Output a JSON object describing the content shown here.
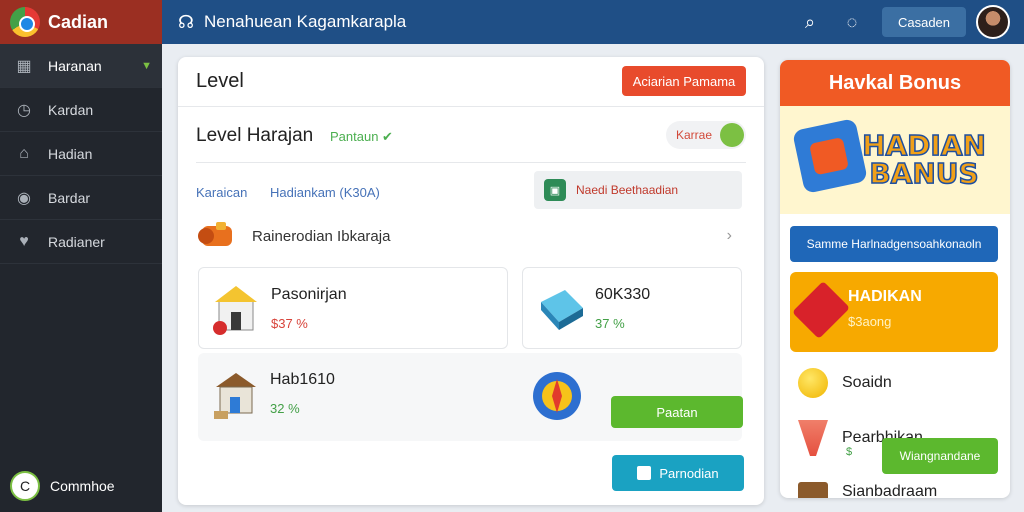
{
  "sidebar": {
    "brand": "Cadian",
    "items": [
      {
        "label": "Haranan",
        "icon": "grid-icon",
        "active": true
      },
      {
        "label": "Kardan",
        "icon": "clock-icon",
        "active": false
      },
      {
        "label": "Hadian",
        "icon": "home-icon",
        "active": false
      },
      {
        "label": "Bardar",
        "icon": "circle-icon",
        "active": false
      },
      {
        "label": "Radianer",
        "icon": "heart-icon",
        "active": false
      }
    ],
    "footer": {
      "label": "Commhoe",
      "avatar": "C"
    }
  },
  "topbar": {
    "title": "Nenahuean Kagamkarapla",
    "button": "Casaden"
  },
  "main": {
    "title": "Level",
    "header_button": "Aciarian Pamama",
    "level_title": "Level Harajan",
    "level_status": "Pantaun ✔",
    "toggle_label": "Karrae",
    "sub_label": "Karaican",
    "sub_code": "Hadiankam (K30A)",
    "notice": "Naedi Beethaadian",
    "row_item": "Rainerodian Ibkaraja",
    "cards": [
      {
        "title": "Pasonirjan",
        "stat": "$37 %",
        "color": "red"
      },
      {
        "title": "60K330",
        "stat": "37 %",
        "color": "green"
      },
      {
        "title": "Hab1610",
        "stat": "32 %",
        "color": "red"
      }
    ],
    "green_button": "Paatan",
    "teal_button": "Parnodian"
  },
  "right": {
    "header": "Havkal Bonus",
    "banner": "HADIAN BANUS",
    "strip": "Samme Harlnadgensoahkonaoln",
    "yellow_title": "HADIKAN",
    "yellow_sub": "$3aong",
    "items": [
      {
        "label": "Soaidn",
        "icon": "coin-icon"
      },
      {
        "label": "Pearbhikan",
        "icon": "cup-icon"
      }
    ],
    "sub_stat": "$",
    "green_button": "Wiangnandane",
    "bottom_item": "Sianbadraam"
  },
  "colors": {
    "sidebar_bg": "#22262d",
    "brand_bg": "#9b2f22",
    "topbar_bg": "#1f4f86",
    "accent_red": "#e84b2c",
    "accent_green": "#5cb82e",
    "accent_teal": "#1aa2c2",
    "bonus_orange": "#f05a24",
    "bonus_yellow": "#f7a900"
  }
}
